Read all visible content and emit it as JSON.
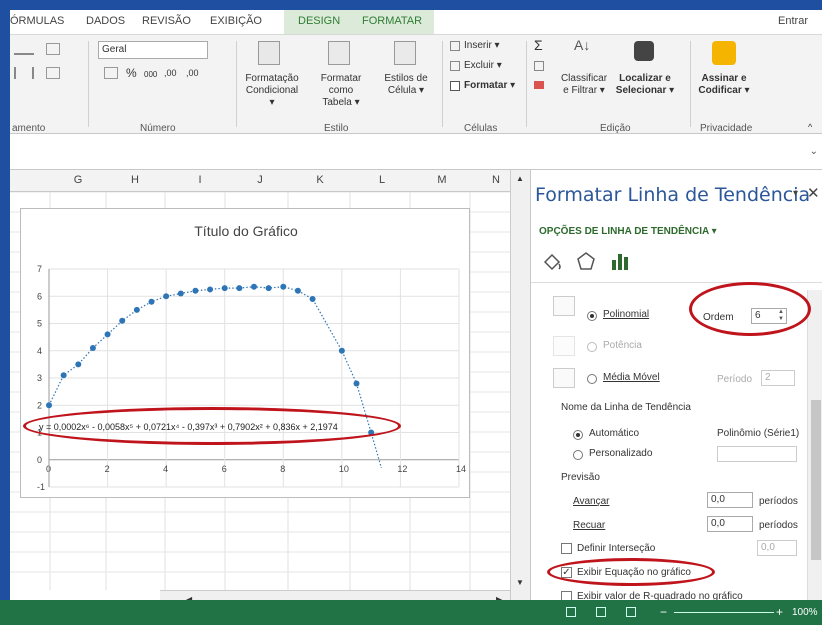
{
  "tabs": [
    "ÓRMULAS",
    "DADOS",
    "REVISÃO",
    "EXIBIÇÃO",
    "DESIGN",
    "FORMATAR"
  ],
  "account": "Entrar",
  "ribbon": {
    "number_format": "Geral",
    "groups": [
      "amento",
      "Número",
      "Estilo",
      "Células",
      "Edição",
      "Privacidade"
    ],
    "buttons": {
      "cond_format": [
        "Formatação",
        "Condicional ▾"
      ],
      "format_table": [
        "Formatar como",
        "Tabela ▾"
      ],
      "cell_styles": [
        "Estilos de",
        "Célula ▾"
      ],
      "insert": "Inserir ▾",
      "delete": "Excluir ▾",
      "format": "Formatar ▾",
      "sort": [
        "Classificar",
        "e Filtrar ▾"
      ],
      "find": [
        "Localizar e",
        "Selecionar ▾"
      ],
      "sign": [
        "Assinar e",
        "Codificar ▾"
      ]
    }
  },
  "sheet": {
    "columns": [
      "G",
      "H",
      "I",
      "J",
      "K",
      "L",
      "M",
      "N"
    ]
  },
  "chart_data": {
    "type": "scatter",
    "title": "Título do Gráfico",
    "xlim": [
      0,
      14
    ],
    "ylim": [
      -1,
      7
    ],
    "x_ticks": [
      "0",
      "2",
      "4",
      "6",
      "8",
      "10",
      "12",
      "14"
    ],
    "y_ticks": [
      "-1",
      "0",
      "1",
      "2",
      "3",
      "4",
      "5",
      "6",
      "7"
    ],
    "series": [
      {
        "points": [
          [
            0,
            2.0
          ],
          [
            0.5,
            3.1
          ],
          [
            1,
            3.5
          ],
          [
            1.5,
            4.1
          ],
          [
            2,
            4.6
          ],
          [
            2.5,
            5.1
          ],
          [
            3,
            5.5
          ],
          [
            3.5,
            5.8
          ],
          [
            4,
            6.0
          ],
          [
            4.5,
            6.1
          ],
          [
            5,
            6.2
          ],
          [
            5.5,
            6.25
          ],
          [
            6,
            6.3
          ],
          [
            6.5,
            6.3
          ],
          [
            7,
            6.35
          ],
          [
            7.5,
            6.3
          ],
          [
            8,
            6.35
          ],
          [
            8.5,
            6.2
          ],
          [
            9,
            5.9
          ],
          [
            10,
            4.0
          ],
          [
            10.5,
            2.8
          ],
          [
            11,
            1.0
          ]
        ]
      }
    ],
    "trendline": {
      "type": "polynomial",
      "order": 6,
      "equation": "y = 0,0002x⁶ - 0,0058x⁵ + 0,0721x⁴ - 0,397x³ + 0,7902x² + 0,836x + 2,1974"
    },
    "grid": true,
    "point_color": "#2e75b6"
  },
  "pane": {
    "title": "Formatar Linha de Tendência",
    "section": "OPÇÕES DE LINHA DE TENDÊNCIA",
    "polinomial": "Polinomial",
    "order_label": "Ordem",
    "order_value": "6",
    "potencia": "Potência",
    "media_movel": "Média Móvel",
    "periodo_label": "Período",
    "periodo_value": "2",
    "name_section": "Nome da Linha de Tendência",
    "automatico": "Automático",
    "auto_name": "Polinômio (Série1)",
    "personalizado": "Personalizado",
    "previsao": "Previsão",
    "avancar": "Avançar",
    "avancar_value": "0,0",
    "recuar": "Recuar",
    "recuar_value": "0,0",
    "periodos": "períodos",
    "intersecao": "Definir Interseção",
    "intersecao_value": "0,0",
    "exibir_eq": "Exibir Equação no gráfico",
    "exibir_r2": "Exibir valor de R-quadrado no gráfico"
  },
  "status": {
    "zoom": "100%"
  }
}
